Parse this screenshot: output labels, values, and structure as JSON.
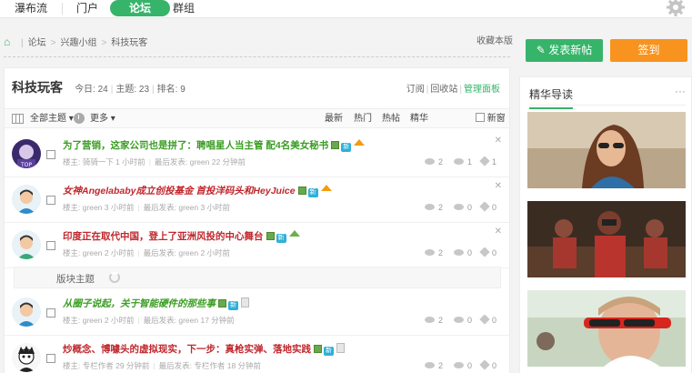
{
  "topnav": {
    "tabs": [
      {
        "label": "瀑布流",
        "active": false
      },
      {
        "label": "门户",
        "active": false
      },
      {
        "label": "论坛",
        "active": true
      },
      {
        "label": "群组",
        "active": false
      }
    ],
    "settings_icon": "gear-icon"
  },
  "breadcrumb": {
    "home_icon": "home-icon",
    "items": [
      "论坛",
      "兴趣小组",
      "科技玩客"
    ],
    "favorite": "收藏本版"
  },
  "forum": {
    "name": "科技玩客",
    "today": "今日: 24",
    "topics": "主题: 23",
    "rank": "排名: 9",
    "options": [
      "订阅",
      "回收站",
      "管理面板"
    ]
  },
  "filter": {
    "all_topics": "全部主题",
    "more": "更多",
    "sorts": [
      "最新",
      "热门",
      "热帖",
      "精华"
    ],
    "new_window": "新窗"
  },
  "threads": [
    {
      "title": "为了营销，这家公司也是拼了：聘唱星人当主管 配4名美女秘书",
      "style": "green",
      "author": "楼主: 骑骑一下  1 小时前",
      "last": "最后发表: green 22 分钟前",
      "views": "2",
      "replies": "1",
      "likes": "1",
      "icons": [
        "image",
        "new",
        "up"
      ]
    },
    {
      "title": "女神Angelababy成立创投基金 首投洋码头和HeyJuice",
      "style": "red-italic",
      "author": "楼主: green  3 小时前",
      "last": "最后发表: green 3 小时前",
      "views": "2",
      "replies": "0",
      "likes": "0",
      "icons": [
        "image",
        "new",
        "up"
      ]
    },
    {
      "title": "印度正在取代中国，登上了亚洲风投的中心舞台",
      "style": "red",
      "author": "楼主: green  2 小时前",
      "last": "最后发表: green 2 小时前",
      "views": "2",
      "replies": "0",
      "likes": "0",
      "icons": [
        "image",
        "new",
        "up"
      ]
    },
    {
      "title": "从圈子说起，关于智能硬件的那些事",
      "style": "green-italic",
      "author": "楼主: green  2 小时前",
      "last": "最后发表: green 17 分钟前",
      "views": "2",
      "replies": "0",
      "likes": "0",
      "icons": [
        "image",
        "new",
        "attach"
      ]
    },
    {
      "title": "炒概念、博噱头的虚拟现实，下一步：真枪实弹、落地实践",
      "style": "red",
      "author": "楼主: 专栏作者  29 分钟前",
      "last": "最后发表: 专栏作者 18 分钟前",
      "views": "2",
      "replies": "0",
      "likes": "0",
      "icons": [
        "image",
        "new",
        "attach"
      ]
    }
  ],
  "section_label": "版块主题",
  "sidebar": {
    "post_button": "发表新帖",
    "sign_button": "签到",
    "digest_title": "精华导读",
    "more": "···"
  }
}
